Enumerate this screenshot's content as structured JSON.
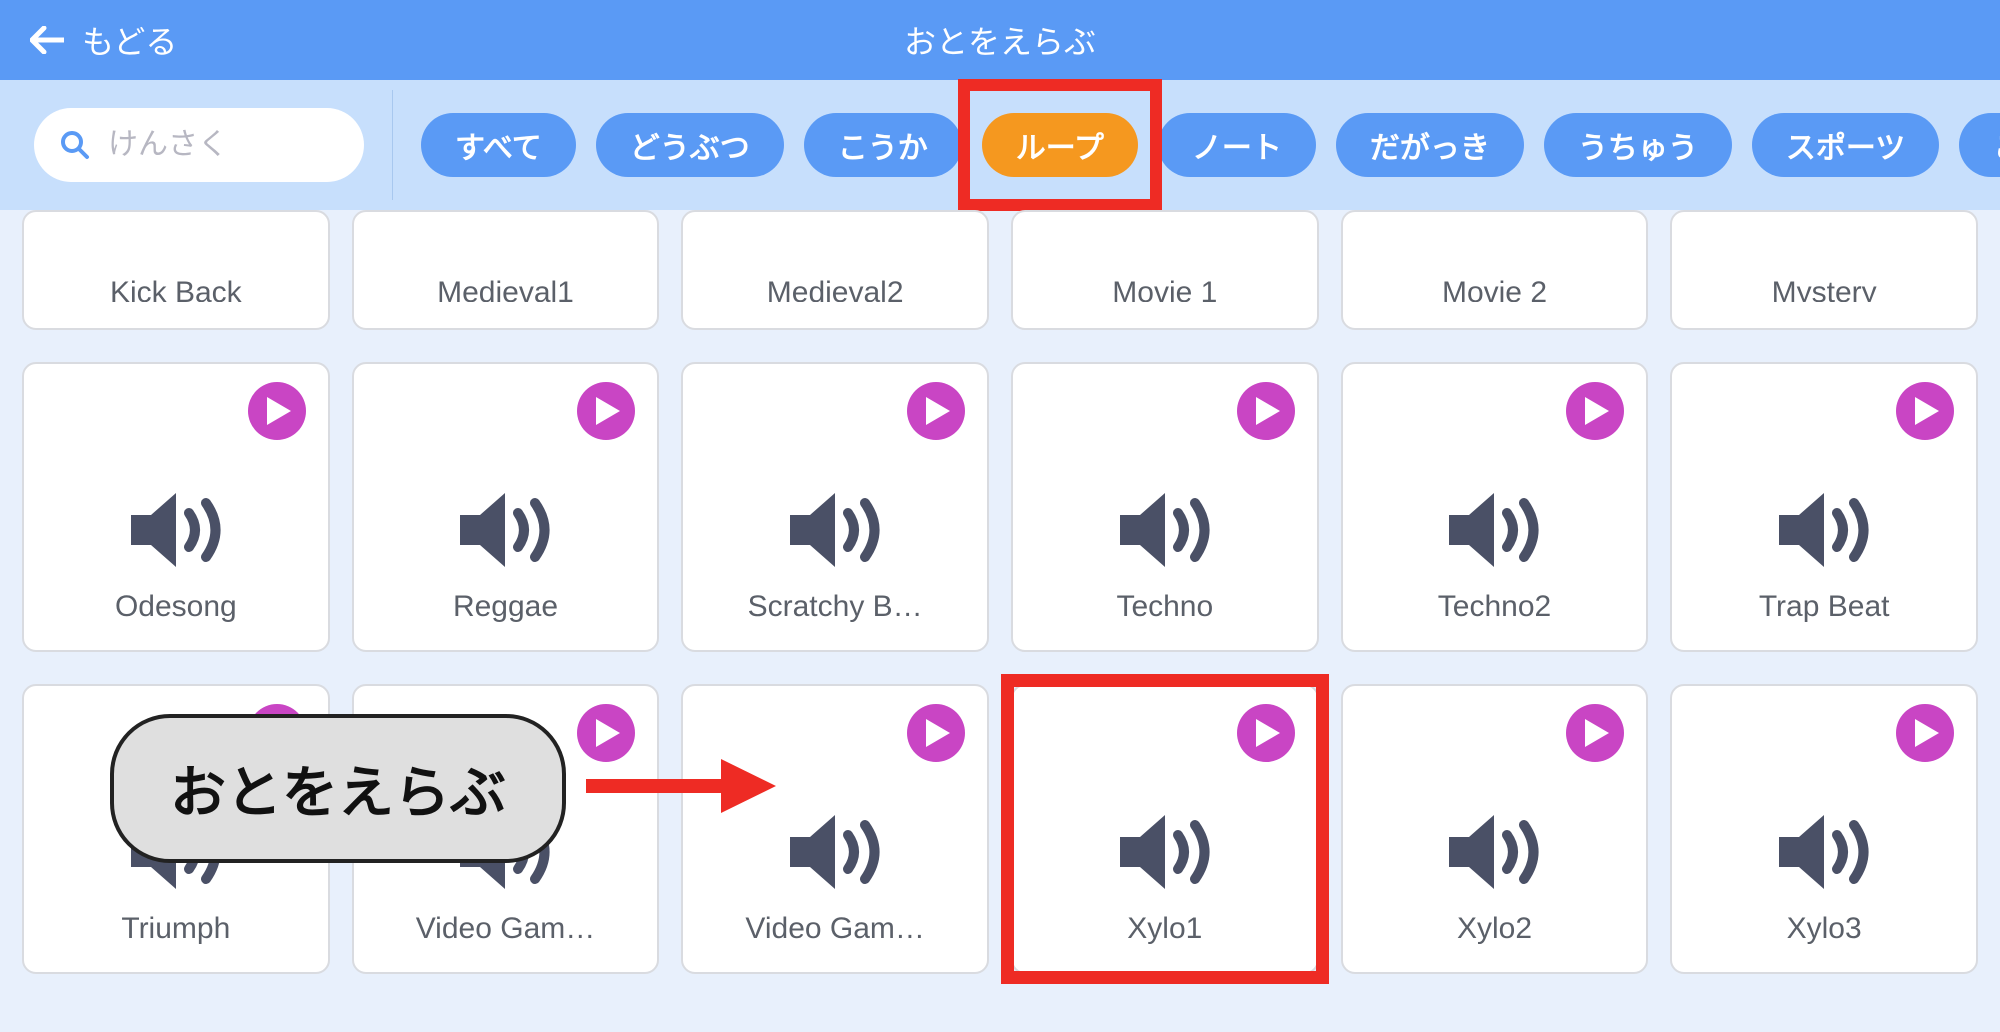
{
  "header": {
    "back_label": "もどる",
    "title": "おとをえらぶ"
  },
  "search": {
    "placeholder": "けんさく"
  },
  "filters": [
    {
      "label": "すべて",
      "active": false
    },
    {
      "label": "どうぶつ",
      "active": false
    },
    {
      "label": "こうか",
      "active": false
    },
    {
      "label": "ループ",
      "active": true
    },
    {
      "label": "ノート",
      "active": false
    },
    {
      "label": "だがっき",
      "active": false
    },
    {
      "label": "うちゅう",
      "active": false
    },
    {
      "label": "スポーツ",
      "active": false
    },
    {
      "label": "こえ",
      "active": false
    }
  ],
  "sounds_row1": [
    {
      "label": "Kick Back"
    },
    {
      "label": "Medieval1"
    },
    {
      "label": "Medieval2"
    },
    {
      "label": "Movie 1"
    },
    {
      "label": "Movie 2"
    },
    {
      "label": "Mystery"
    }
  ],
  "sounds_row2": [
    {
      "label": "Odesong"
    },
    {
      "label": "Reggae"
    },
    {
      "label": "Scratchy B…"
    },
    {
      "label": "Techno"
    },
    {
      "label": "Techno2"
    },
    {
      "label": "Trap Beat"
    }
  ],
  "sounds_row3": [
    {
      "label": "Triumph"
    },
    {
      "label": "Video Gam…"
    },
    {
      "label": "Video Gam…"
    },
    {
      "label": "Xylo1"
    },
    {
      "label": "Xylo2"
    },
    {
      "label": "Xylo3"
    }
  ],
  "annotations": {
    "callout_text": "おとをえらぶ",
    "highlighted_filter_index": 3,
    "highlighted_card": "Xylo1"
  },
  "colors": {
    "header_bg": "#5a9af5",
    "filter_bg": "#c7dffc",
    "chip_bg": "#5a9af5",
    "chip_active_bg": "#f5981f",
    "play_bg": "#c945c4",
    "highlight": "#ee2b24",
    "sound_icon": "#4a5066"
  }
}
